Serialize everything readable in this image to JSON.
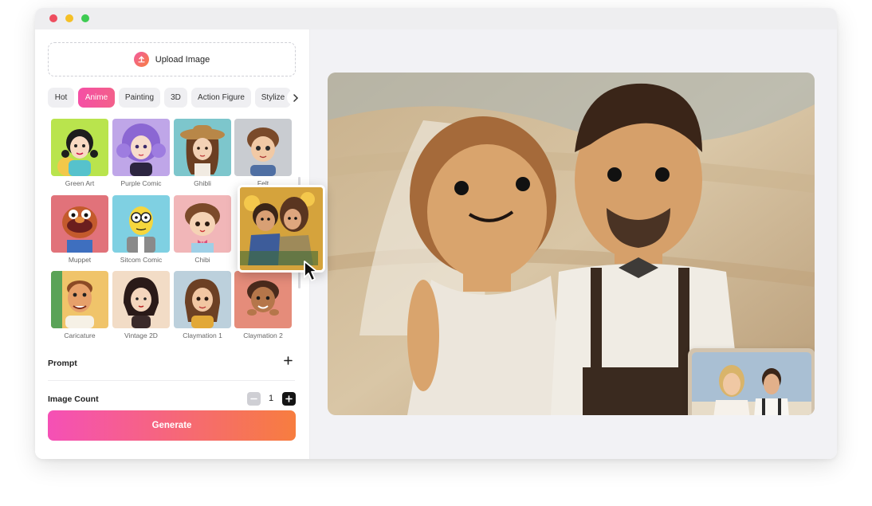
{
  "window": {
    "controls": [
      "close",
      "minimize",
      "maximize"
    ]
  },
  "upload": {
    "label": "Upload Image",
    "icon": "upload-icon"
  },
  "tabs": [
    {
      "label": "Hot",
      "active": false
    },
    {
      "label": "Anime",
      "active": true
    },
    {
      "label": "Painting",
      "active": false
    },
    {
      "label": "3D",
      "active": false
    },
    {
      "label": "Action Figure",
      "active": false
    },
    {
      "label": "Stylize",
      "active": false
    }
  ],
  "tabs_next_icon": "chevron-right-icon",
  "styles": [
    {
      "label": "Green Art"
    },
    {
      "label": "Purple Comic"
    },
    {
      "label": "Ghibli"
    },
    {
      "label": "Felt"
    },
    {
      "label": "Muppet"
    },
    {
      "label": "Sitcom Comic"
    },
    {
      "label": "Chibi"
    },
    {
      "label": "Caricature"
    },
    {
      "label": "Vintage 2D"
    },
    {
      "label": "Claymation 1"
    },
    {
      "label": "Claymation 2"
    }
  ],
  "prompt": {
    "label": "Prompt",
    "icon": "plus-icon"
  },
  "image_count": {
    "label": "Image Count",
    "value": "1",
    "minus_icon": "minus-icon",
    "plus_icon": "plus-icon"
  },
  "generate": {
    "label": "Generate"
  },
  "colors": {
    "accent_start": "#f550b6",
    "accent_end": "#f77d3f",
    "active_tab": "#f54fa5"
  }
}
